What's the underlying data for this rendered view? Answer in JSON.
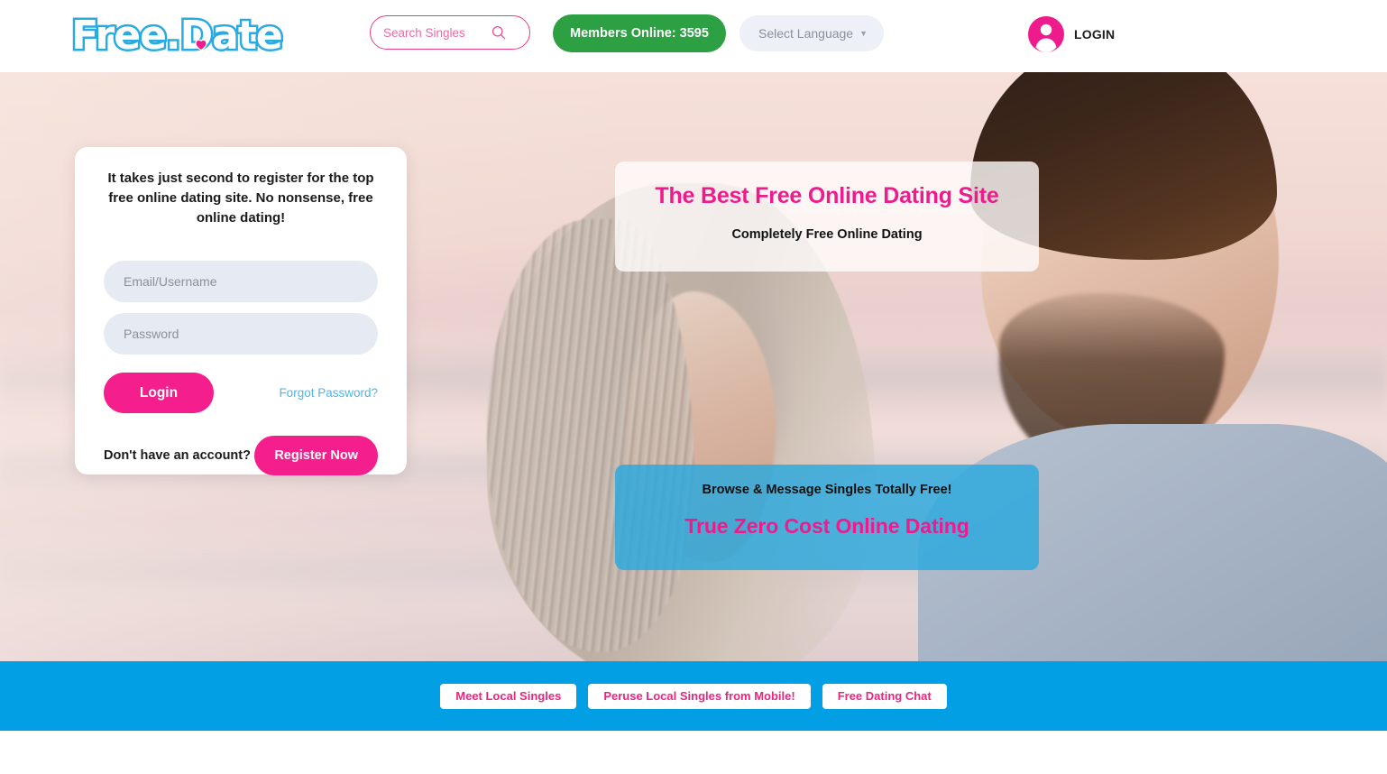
{
  "header": {
    "logo": {
      "text_primary": "Free",
      "text_secondary": "Date",
      "separator": ".",
      "full": "Free.Date",
      "icon": "heart-icon",
      "outline_color": "#29ABE2",
      "heart_color": "#EE1B8D"
    },
    "search": {
      "placeholder": "Search Singles",
      "value": "",
      "icon": "search-icon",
      "border_color": "#ED3B8A"
    },
    "members_button": {
      "label": "Members Online: 3595",
      "count": 3595,
      "color": "#2DA044"
    },
    "language_select": {
      "selected": "Select Language",
      "caret": "▼",
      "background": "#EDF1F7"
    },
    "login": {
      "label": "LOGIN",
      "icon": "user-avatar-icon",
      "avatar_color": "#EE1B8D"
    }
  },
  "login_card": {
    "headline": "It takes just second to register for the top free online dating site. No nonsense, free online dating!",
    "email_placeholder": "Email/Username",
    "email_value": "",
    "password_placeholder": "Password",
    "password_value": "",
    "login_button": "Login",
    "forgot_link": "Forgot Password?",
    "no_account_text": "Don't have an account?",
    "register_button": "Register Now",
    "accent_color": "#F41E8C",
    "link_color": "#4BB8ED"
  },
  "hero": {
    "top_panel": {
      "title": "The Best Free Online Dating Site",
      "subtitle": "Completely Free Online Dating",
      "title_color": "#EE1B8D",
      "background": "rgba(255,253,253,.80)"
    },
    "bottom_panel": {
      "subtitle": "Browse & Message Singles Totally Free!",
      "title": "True Zero Cost Online Dating",
      "title_color": "#EE1B8D",
      "background": "rgba(41,168,222,.82)"
    }
  },
  "bottom_bar": {
    "background": "#029FE5",
    "buttons": [
      {
        "label": "Meet Local Singles"
      },
      {
        "label": "Peruse Local Singles from Mobile!"
      },
      {
        "label": "Free Dating Chat"
      }
    ],
    "button_text_color": "#E8277F"
  }
}
